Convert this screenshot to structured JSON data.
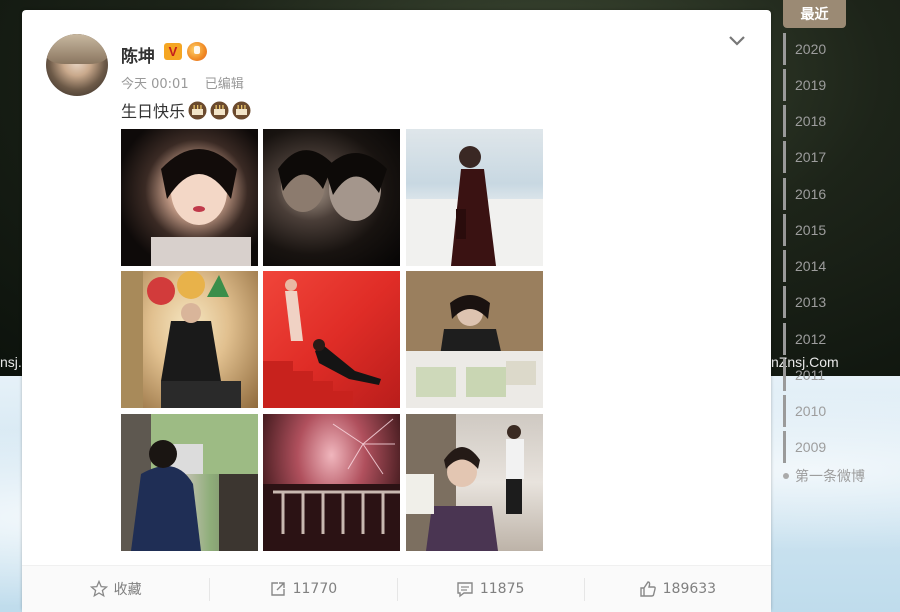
{
  "post": {
    "username": "陈坤",
    "verified_badge": "V",
    "time": "今天 00:01",
    "edited": "已编辑",
    "text": "生日快乐",
    "emoji_count": 3
  },
  "actions": {
    "favorite": "收藏",
    "forward_count": "11770",
    "comment_count": "11875",
    "like_count": "189633"
  },
  "timeline": {
    "recent": "最近",
    "years": [
      "2020",
      "2019",
      "2018",
      "2017",
      "2016",
      "2015",
      "2014",
      "2013",
      "2012",
      "2011",
      "2010",
      "2009"
    ],
    "first": "第一条微博"
  },
  "watermark": {
    "left": "nsj.C",
    "right": "nZnsj.Com"
  },
  "icons": {
    "chevron": "chevron-down-icon",
    "favorite": "star-icon",
    "forward": "share-icon",
    "comment": "comment-icon",
    "like": "thumbs-up-icon",
    "emoji": "birthday-cake-icon"
  }
}
